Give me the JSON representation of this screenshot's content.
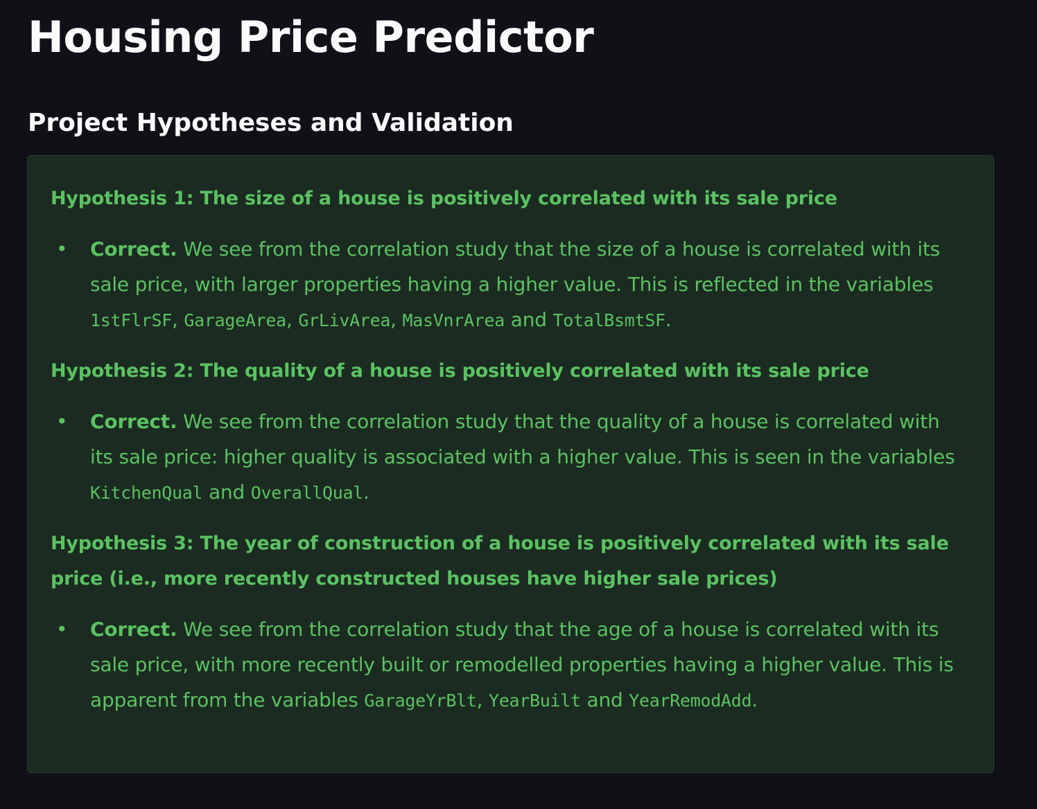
{
  "page": {
    "title": "Housing Price Predictor",
    "section_title": "Project Hypotheses and Validation"
  },
  "colors": {
    "background": "#0f1117",
    "success_box_bg": "#1b2b21",
    "success_text": "#5bc262",
    "title_text": "#fafafa"
  },
  "hypotheses": [
    {
      "heading": "Hypothesis 1: The size of a house is positively correlated with its sale price",
      "verdict": "Correct.",
      "text": " We see from the correlation study that the size of a house is correlated with its sale price, with larger properties having a higher value. This is reflected in the variables ",
      "vars": [
        "1stFlrSF",
        "GarageArea",
        "GrLivArea",
        "MasVnrArea",
        "TotalBsmtSF"
      ],
      "sep_comma": ", ",
      "sep_and": " and ",
      "end": "."
    },
    {
      "heading": "Hypothesis 2: The quality of a house is positively correlated with its sale price",
      "verdict": "Correct.",
      "text": " We see from the correlation study that the quality of a house is correlated with its sale price: higher quality is associated with a higher value. This is seen in the variables ",
      "vars": [
        "KitchenQual",
        "OverallQual"
      ],
      "sep_and": " and ",
      "end": "."
    },
    {
      "heading": "Hypothesis 3: The year of construction of a house is positively correlated with its sale price (i.e., more recently constructed houses have higher sale prices)",
      "verdict": "Correct.",
      "text": " We see from the correlation study that the age of a house is correlated with its sale price, with more recently built or remodelled properties having a higher value. This is apparent from the variables ",
      "vars": [
        "GarageYrBlt",
        "YearBuilt",
        "YearRemodAdd"
      ],
      "sep_comma": ", ",
      "sep_and": " and ",
      "end": "."
    }
  ]
}
